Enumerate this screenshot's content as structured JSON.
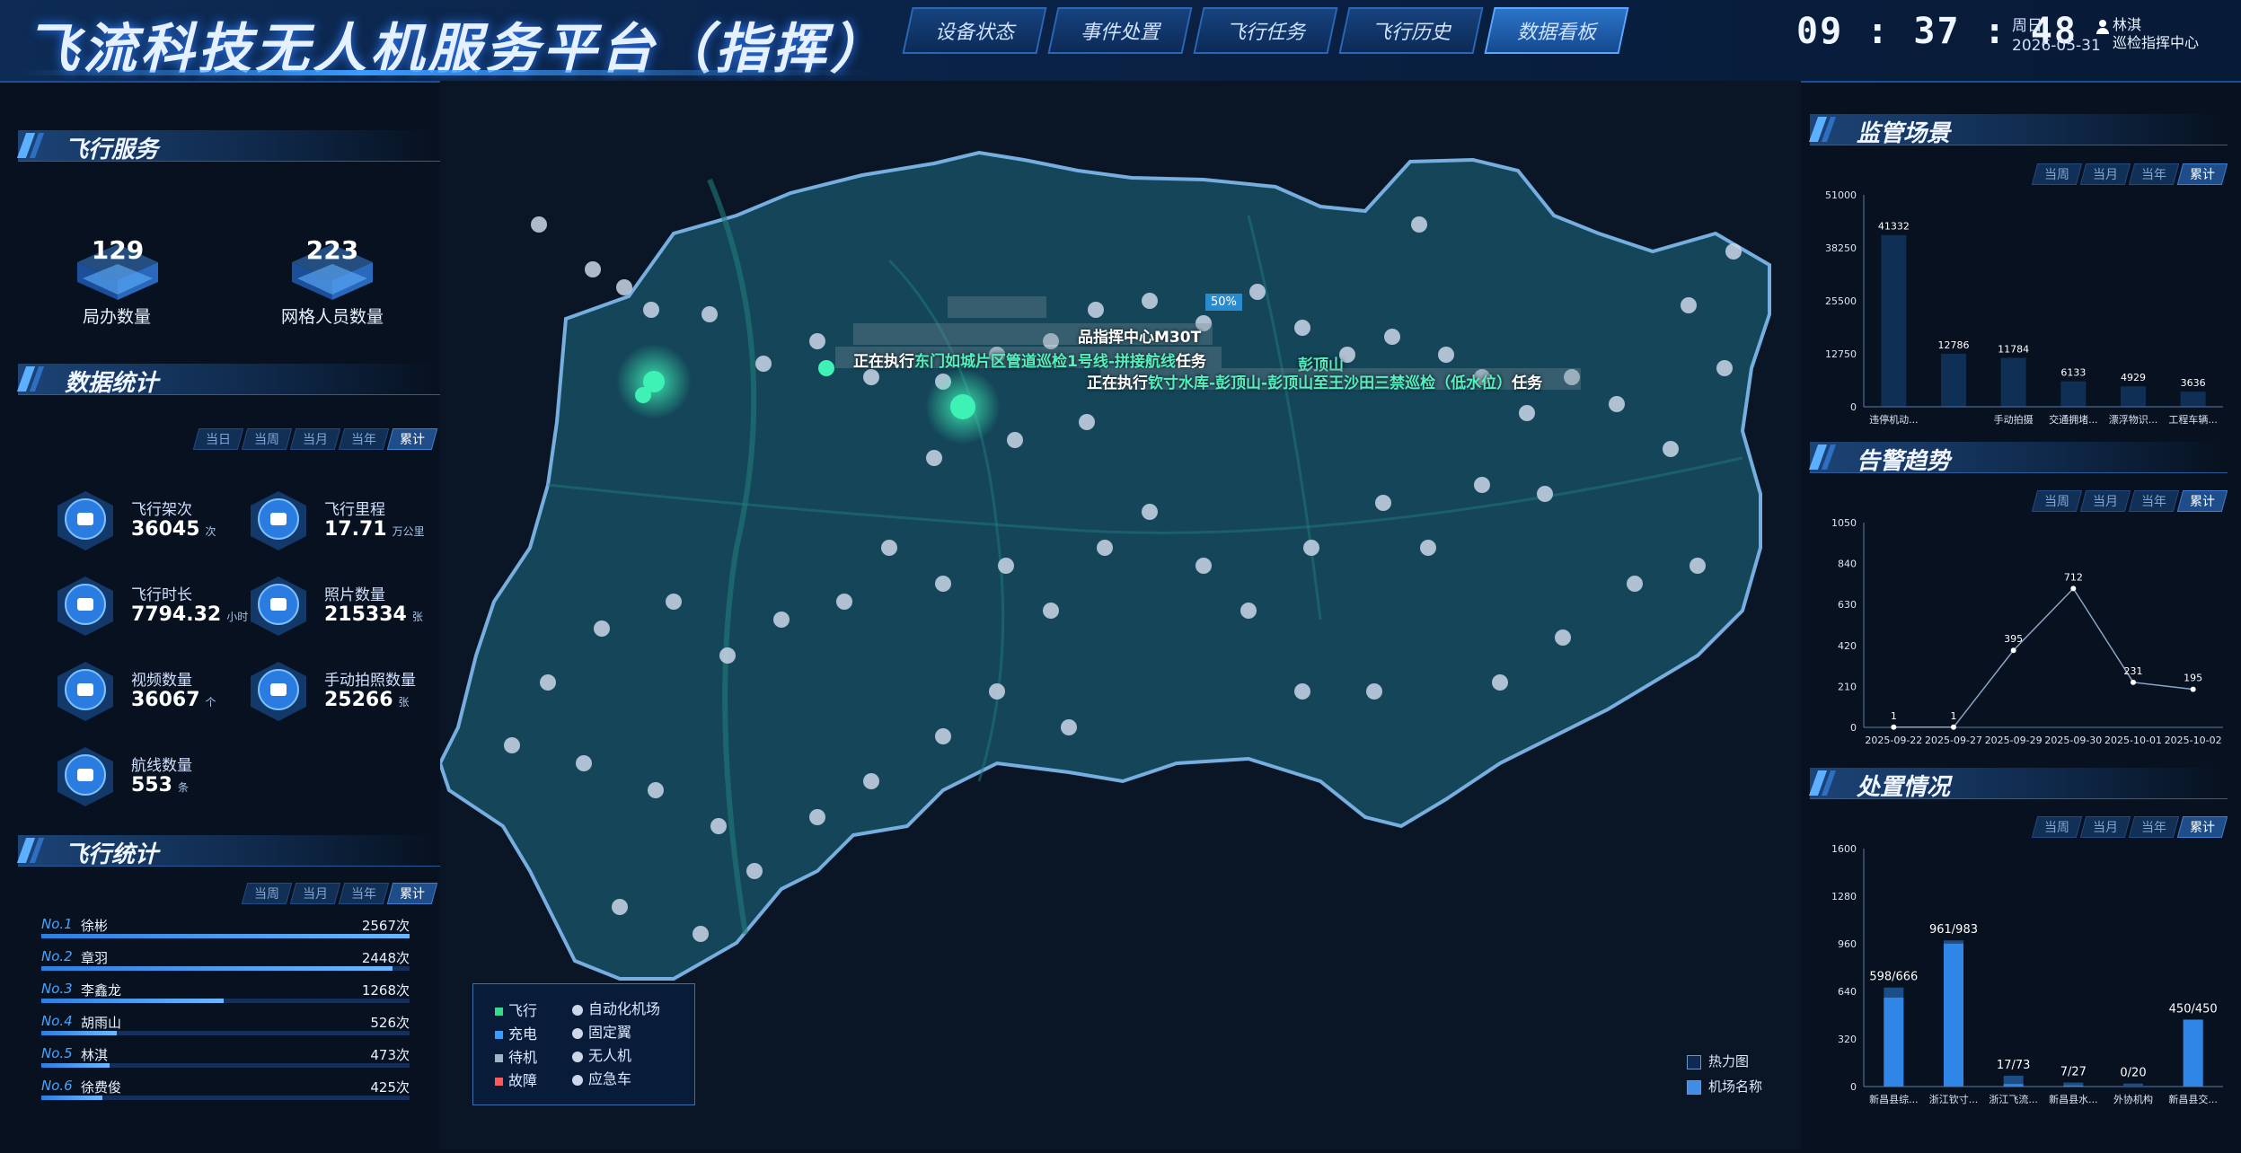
{
  "header": {
    "title": "飞流科技无人机服务平台（指挥）",
    "nav": [
      "设备状态",
      "事件处置",
      "飞行任务",
      "飞行历史",
      "数据看板"
    ],
    "active_nav": 4,
    "time": "09 : 37 : 48",
    "weekday": "周日",
    "date": "2026-05-31",
    "user_name": "林淇",
    "user_org": "巡检指挥中心"
  },
  "period_tabs": [
    "当日",
    "当周",
    "当月",
    "当年",
    "累计"
  ],
  "flight_tabs": [
    "当周",
    "当月",
    "当年",
    "累计"
  ],
  "flight_service": {
    "title": "飞行服务",
    "office_count": "129",
    "office_label": "局办数量",
    "grid_count": "223",
    "grid_label": "网格人员数量"
  },
  "data_stats": {
    "title": "数据统计",
    "items": [
      {
        "label": "飞行架次",
        "value": "36045",
        "unit": "次",
        "icon": "airplane-icon"
      },
      {
        "label": "飞行里程",
        "value": "17.71",
        "unit": "万公里",
        "icon": "speedometer-icon"
      },
      {
        "label": "飞行时长",
        "value": "7794.32",
        "unit": "小时",
        "icon": "clock-icon"
      },
      {
        "label": "照片数量",
        "value": "215334",
        "unit": "张",
        "icon": "photo-icon"
      },
      {
        "label": "视频数量",
        "value": "36067",
        "unit": "个",
        "icon": "video-icon"
      },
      {
        "label": "手动拍照数量",
        "value": "25266",
        "unit": "张",
        "icon": "camera-icon"
      },
      {
        "label": "航线数量",
        "value": "553",
        "unit": "条",
        "icon": "route-icon"
      }
    ]
  },
  "flight_stats": {
    "title": "飞行统计",
    "ranking": [
      {
        "no": "No.1",
        "name": "徐彬",
        "count": "2567次",
        "value": 2567
      },
      {
        "no": "No.2",
        "name": "章羽",
        "count": "2448次",
        "value": 2448
      },
      {
        "no": "No.3",
        "name": "李鑫龙",
        "count": "1268次",
        "value": 1268
      },
      {
        "no": "No.4",
        "name": "胡雨山",
        "count": "526次",
        "value": 526
      },
      {
        "no": "No.5",
        "name": "林淇",
        "count": "473次",
        "value": 473
      },
      {
        "no": "No.6",
        "name": "徐费俊",
        "count": "425次",
        "value": 425
      }
    ]
  },
  "map": {
    "label_dock": "品指挥中心M30T",
    "label_task1_prefix": "正在执行",
    "label_task1_hl": "东门如城片区管道巡检1号线-拼接航线",
    "label_task1_suffix": "任务",
    "label_peak": "彭顶山",
    "label_task2_prefix": "正在执行",
    "label_task2_hl": "钦寸水库-彭顶山-彭顶山至王沙田三禁巡检（低水位）",
    "label_task2_suffix": "任务",
    "battery": "50%",
    "legend_status": [
      {
        "label": "飞行",
        "color": "#39d98a"
      },
      {
        "label": "充电",
        "color": "#3b9cff"
      },
      {
        "label": "待机",
        "color": "#9fb3c8"
      },
      {
        "label": "故障",
        "color": "#ff5a5a"
      }
    ],
    "legend_types": [
      {
        "label": "自动化机场",
        "icon": "hangar-icon"
      },
      {
        "label": "固定翼",
        "icon": "fixed-wing-icon"
      },
      {
        "label": "无人机",
        "icon": "drone-icon"
      },
      {
        "label": "应急车",
        "icon": "vehicle-icon"
      }
    ],
    "toggles": [
      {
        "label": "热力图",
        "checked": false
      },
      {
        "label": "机场名称",
        "checked": true
      }
    ]
  },
  "chart_data": [
    {
      "type": "bar",
      "title": "监管场景",
      "categories": [
        "违停机动...",
        "",
        "手动拍摄",
        "交通拥堵...",
        "漂浮物识...",
        "工程车辆..."
      ],
      "values": [
        41332,
        12786,
        11784,
        6133,
        4929,
        3636
      ],
      "ylim": [
        0,
        51000
      ],
      "yticks": [
        0,
        12750,
        25500,
        38250,
        51000
      ],
      "grid": false
    },
    {
      "type": "line",
      "title": "告警趋势",
      "x": [
        "2025-09-22",
        "2025-09-27",
        "2025-09-29",
        "2025-09-30",
        "2025-10-01",
        "2025-10-02"
      ],
      "values": [
        1,
        1,
        395,
        712,
        231,
        195
      ],
      "point_labels": [
        "1",
        "1",
        "395",
        "712",
        "231",
        "195"
      ],
      "ylim": [
        0,
        1050
      ],
      "yticks": [
        0,
        210,
        420,
        630,
        840,
        1050
      ],
      "grid": false
    },
    {
      "type": "bar",
      "title": "处置情况",
      "categories": [
        "新昌县综...",
        "浙江钦寸...",
        "浙江飞流...",
        "新昌县水...",
        "外协机构",
        "新昌县交..."
      ],
      "series": [
        {
          "values": [
            598,
            961,
            17,
            7,
            0,
            450
          ]
        },
        {
          "values": [
            666,
            983,
            73,
            27,
            20,
            450
          ]
        }
      ],
      "data_labels": [
        "598/666",
        "961/983",
        "17/73",
        "7/27",
        "0/20",
        "450/450"
      ],
      "ylim": [
        0,
        1600
      ],
      "yticks": [
        0,
        320,
        640,
        960,
        1280,
        1600
      ],
      "grid": false
    }
  ],
  "colors": {
    "accent": "#3a9bff",
    "map_fill": "#1a4a5e",
    "map_border": "#6aa8e0",
    "highlight": "#53f0c0"
  }
}
